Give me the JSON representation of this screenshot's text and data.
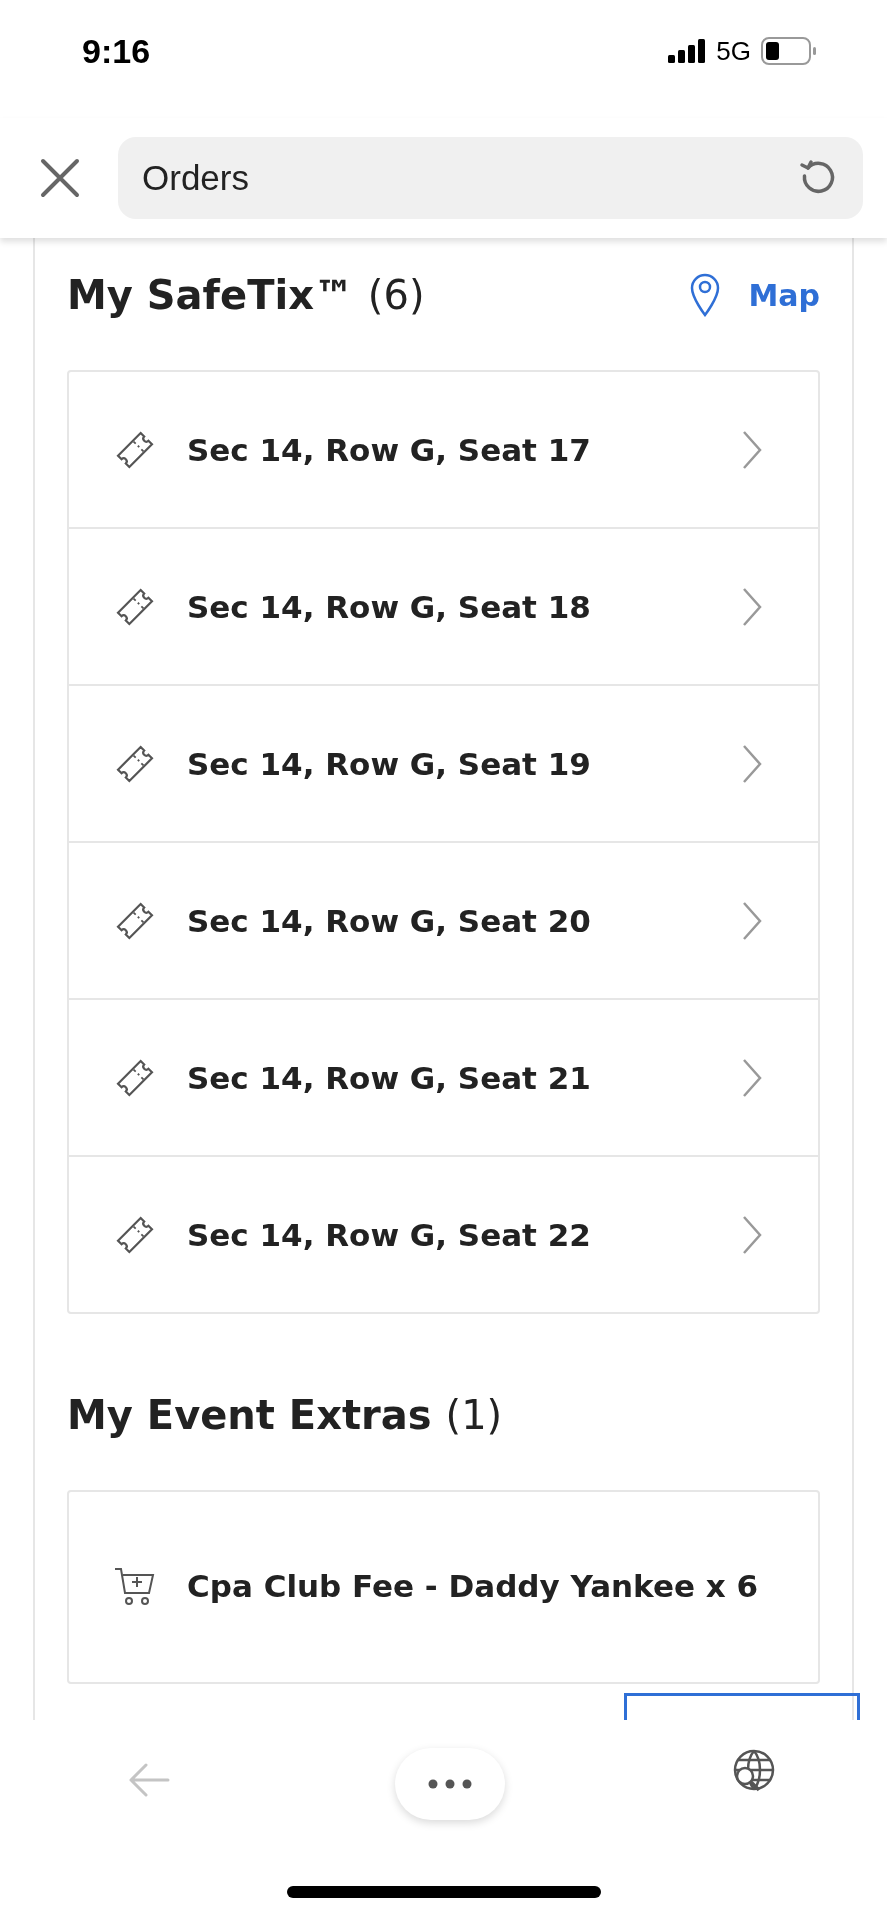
{
  "status_bar": {
    "time": "9:16",
    "network": "5G"
  },
  "browser_bar": {
    "address": "Orders"
  },
  "safetix": {
    "title": "My SafeTix™",
    "count": "(6)",
    "map_link": "Map",
    "tickets": [
      {
        "label": "Sec 14, Row G, Seat 17"
      },
      {
        "label": "Sec 14, Row G, Seat 18"
      },
      {
        "label": "Sec 14, Row G, Seat 19"
      },
      {
        "label": "Sec 14, Row G, Seat 20"
      },
      {
        "label": "Sec 14, Row G, Seat 21"
      },
      {
        "label": "Sec 14, Row G, Seat 22"
      }
    ]
  },
  "extras": {
    "title": "My Event Extras",
    "count": "(1)",
    "items": [
      {
        "label": "Cpa Club Fee - Daddy Yankee x 6"
      }
    ]
  },
  "toolbar": {
    "back_disabled": true
  }
}
